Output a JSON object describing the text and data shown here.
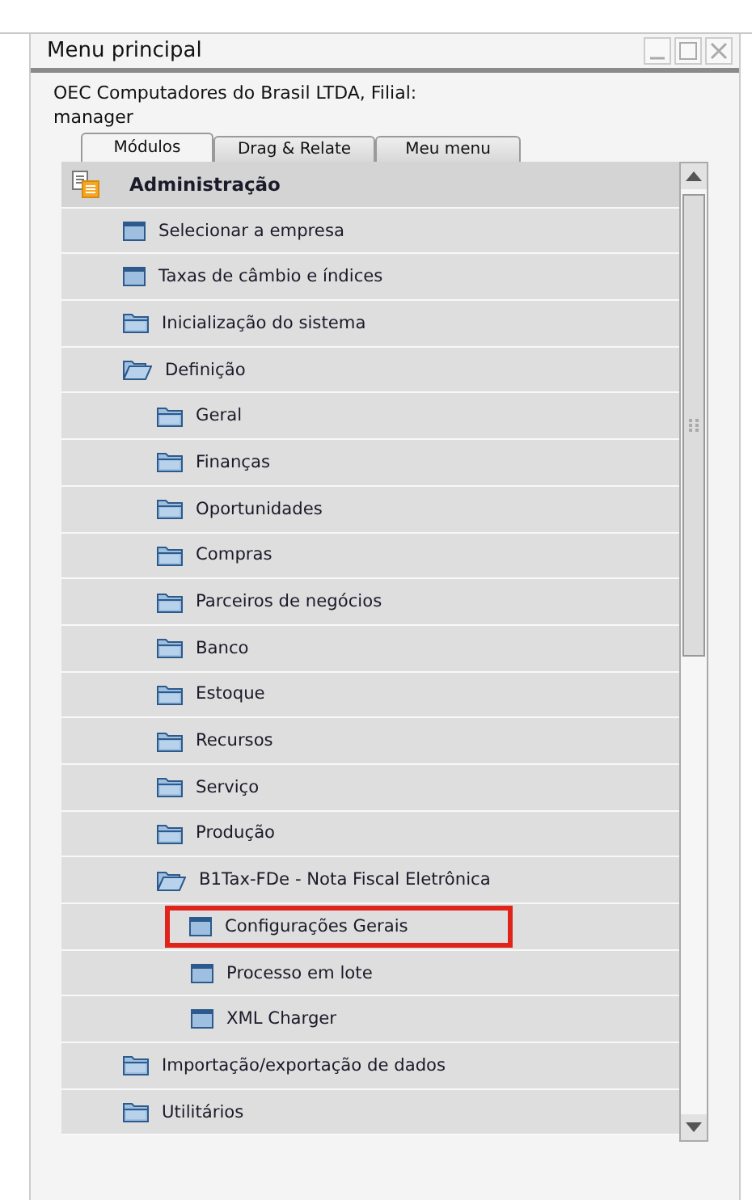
{
  "window": {
    "title": "Menu principal"
  },
  "company": {
    "line1": "OEC Computadores do Brasil LTDA, Filial:",
    "line2": "manager"
  },
  "tabs": [
    {
      "label": "Módulos",
      "selected": true
    },
    {
      "label": "Drag & Relate",
      "selected": false
    },
    {
      "label": "Meu menu",
      "selected": false
    }
  ],
  "tree": [
    {
      "label": "Administração",
      "kind": "module",
      "children": [
        {
          "label": "Selecionar a empresa",
          "kind": "window"
        },
        {
          "label": "Taxas de câmbio e índices",
          "kind": "window"
        },
        {
          "label": "Inicialização do sistema",
          "kind": "folder",
          "expanded": false
        },
        {
          "label": "Definição",
          "kind": "folder",
          "expanded": true,
          "children": [
            {
              "label": "Geral",
              "kind": "folder",
              "expanded": false
            },
            {
              "label": "Finanças",
              "kind": "folder",
              "expanded": false
            },
            {
              "label": "Oportunidades",
              "kind": "folder",
              "expanded": false
            },
            {
              "label": "Compras",
              "kind": "folder",
              "expanded": false
            },
            {
              "label": "Parceiros de negócios",
              "kind": "folder",
              "expanded": false
            },
            {
              "label": "Banco",
              "kind": "folder",
              "expanded": false
            },
            {
              "label": "Estoque",
              "kind": "folder",
              "expanded": false
            },
            {
              "label": "Recursos",
              "kind": "folder",
              "expanded": false
            },
            {
              "label": "Serviço",
              "kind": "folder",
              "expanded": false
            },
            {
              "label": "Produção",
              "kind": "folder",
              "expanded": false
            },
            {
              "label": "B1Tax-FDe - Nota Fiscal Eletrônica",
              "kind": "folder",
              "expanded": true,
              "children": [
                {
                  "label": "Configurações Gerais",
                  "kind": "window",
                  "highlighted": true
                },
                {
                  "label": "Processo em lote",
                  "kind": "window",
                  "highlighted": false
                },
                {
                  "label": "XML Charger",
                  "kind": "window",
                  "highlighted": false
                }
              ]
            }
          ]
        },
        {
          "label": "Importação/exportação de dados",
          "kind": "folder",
          "expanded": false
        },
        {
          "label": "Utilitários",
          "kind": "folder",
          "expanded": false
        }
      ]
    }
  ]
}
